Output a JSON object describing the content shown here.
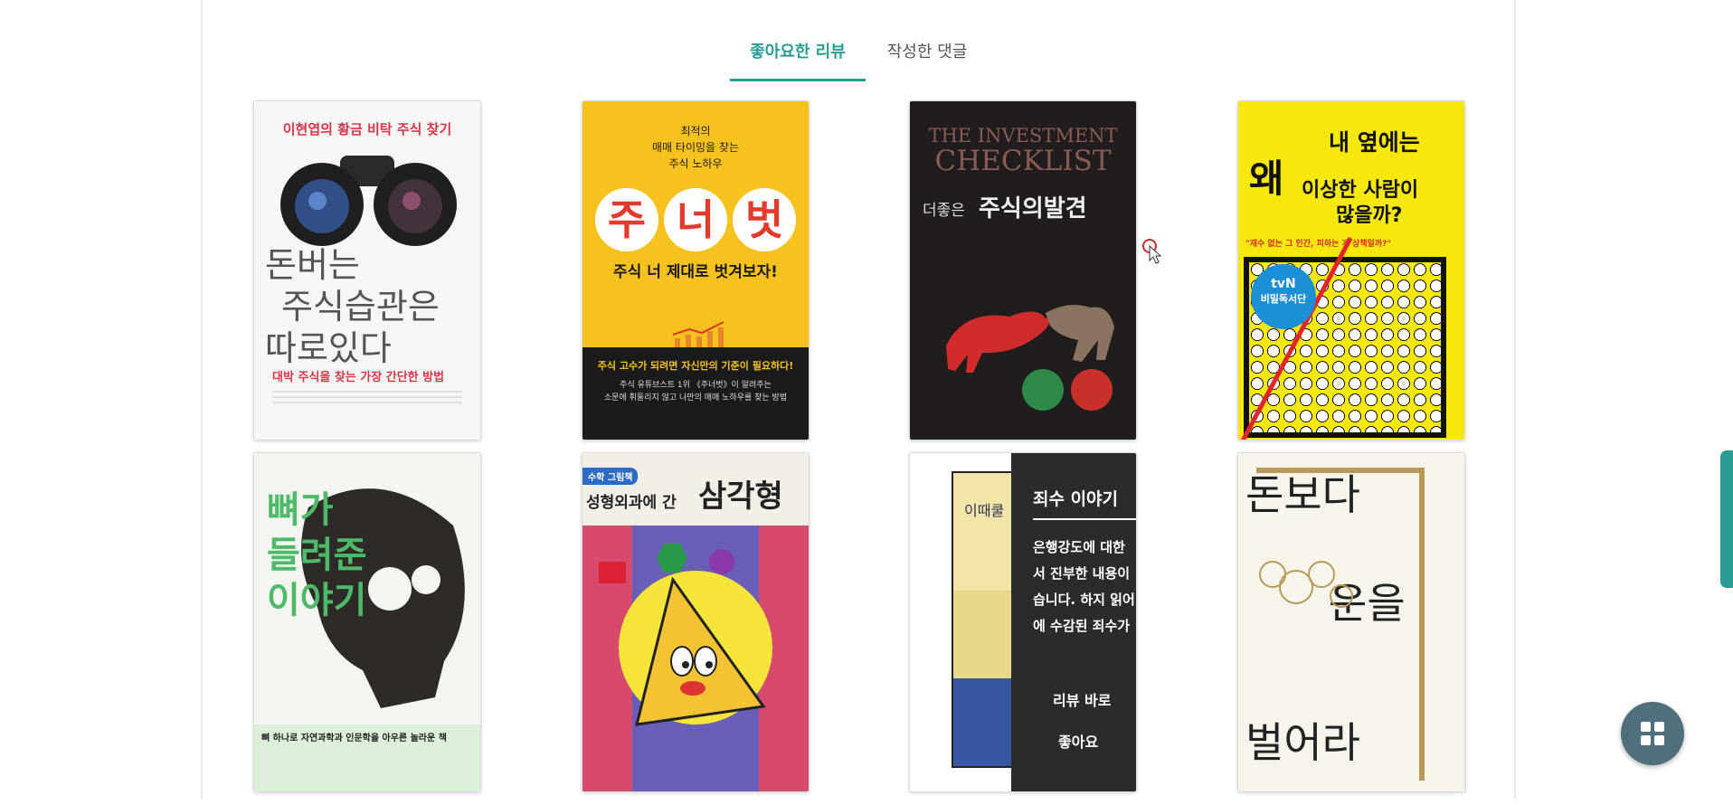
{
  "tabs": [
    {
      "label": "좋아요한 리뷰",
      "active": true
    },
    {
      "label": "작성한 댓글",
      "active": false
    }
  ],
  "books": [
    {
      "top": "이현엽의 황금 비탁 주식 찾기",
      "title_lines": [
        "돈버는",
        "주식습관은",
        "따로있다"
      ],
      "subtitle": "대박 주식을 찾는 가장 간단한 방법"
    },
    {
      "top_lines": [
        "최적의",
        "매매 타이밍을 찾는",
        "주식 노하우"
      ],
      "big": [
        "주",
        "너",
        "벗"
      ],
      "subtitle": "주식 너 제대로 벗겨보자!",
      "band_title": "주식 고수가 되려면 자신만의 기준이 필요하다!",
      "band_lines": [
        "주식 유튜브스트 1위 《주너벗》이 알려주는",
        "소문에 휘둘리지 않고 나만의 매매 노하우를 찾는 방법"
      ]
    },
    {
      "top_lines": [
        "THE INVESTMENT",
        "CHECKLIST"
      ],
      "subtitle_small": "더좋은",
      "subtitle": "주식의발견"
    },
    {
      "top_lines": [
        "내 옆에는",
        "왜",
        "이상한 사람이",
        "많을까?"
      ],
      "tagline": "\"재수 없는 그 인간, 피하는 게 상책일까?\"",
      "badge": [
        "tvN",
        "비밀독서단"
      ]
    },
    {
      "title_lines": [
        "뼈가",
        "들려준",
        "이야기"
      ],
      "subtitle": "뼈 하나로 자연과학과 인문학을 아우른 놀라운 책"
    },
    {
      "badge": "수학 그림책",
      "title_small": "성형외과에 간",
      "title": "삼각형"
    },
    {
      "cover_text": "이때쿨",
      "overlay": {
        "title": "죄수 이야기",
        "text": "은행강도에 대한 \n서 진부한 내용이\n습니다. 하지 읽어\n에 수감된 죄수가",
        "review_button": "리뷰 바로",
        "like_button": "좋아요"
      }
    },
    {
      "title_lines": [
        "돈보다",
        "운을",
        "벌어라"
      ]
    }
  ],
  "colors": {
    "accent": "#2a9d93",
    "fab": "#4f6f7c",
    "overlay": "#2b2b2b"
  },
  "icons": {
    "fab": "grid-icon",
    "cursor": "mouse-pointer-icon"
  }
}
